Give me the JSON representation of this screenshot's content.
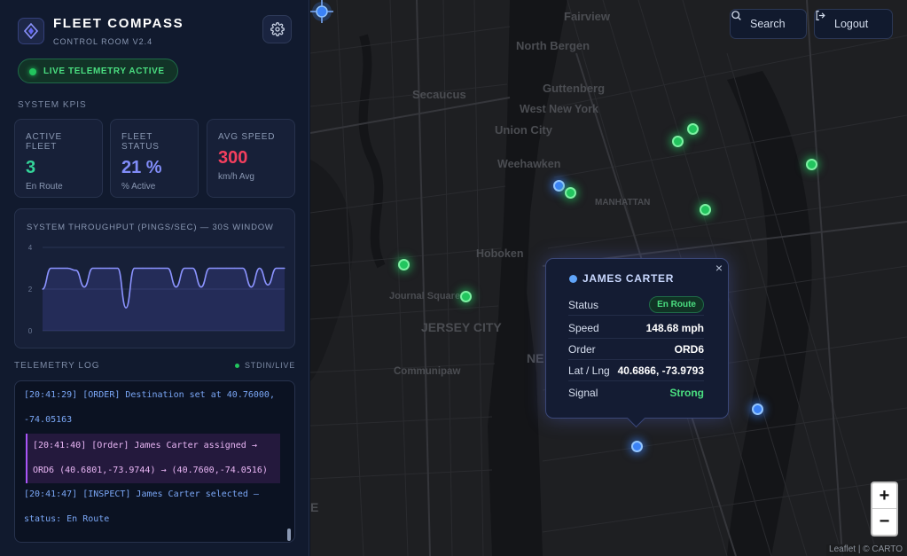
{
  "brand": {
    "title": "FLEET COMPASS",
    "subtitle": "CONTROL ROOM V2.4"
  },
  "icons": {
    "logo": "compass-logo-icon",
    "settings": "gear-icon",
    "search": "search-icon",
    "logout": "logout-icon"
  },
  "live_status": "LIVE TELEMETRY ACTIVE",
  "kpis": {
    "section_label": "SYSTEM KPIS",
    "items": [
      {
        "label": "ACTIVE FLEET",
        "value": "3",
        "unit": "En Route",
        "color": "#34d399"
      },
      {
        "label": "FLEET STATUS",
        "value": "21 %",
        "unit": "% Active",
        "color": "#818cf8"
      },
      {
        "label": "AVG SPEED",
        "value": "300",
        "unit": "km/h Avg",
        "color": "#f43f5e"
      }
    ]
  },
  "chart_data": {
    "type": "line",
    "title": "SYSTEM THROUGHPUT (PINGS/SEC) — 30S WINDOW",
    "ylim": [
      0,
      4
    ],
    "yticks": [
      "4",
      "2",
      "0"
    ],
    "grid": true,
    "x": [
      0,
      1,
      2,
      3,
      4,
      5,
      6,
      7,
      8,
      9,
      10,
      11,
      12,
      13,
      14,
      15,
      16,
      17,
      18,
      19,
      20,
      21,
      22,
      23,
      24,
      25,
      26,
      27,
      28,
      29
    ],
    "values": [
      2.0,
      3.0,
      3.0,
      3.0,
      2.9,
      2.1,
      3.0,
      3.0,
      3.0,
      3.0,
      1.1,
      3.0,
      3.0,
      3.0,
      3.0,
      3.0,
      2.1,
      3.0,
      3.0,
      2.1,
      3.0,
      3.0,
      3.0,
      3.0,
      3.0,
      2.1,
      3.0,
      2.2,
      3.0,
      3.0
    ]
  },
  "log": {
    "title": "TELEMETRY LOG",
    "stream": "STDIN/LIVE",
    "lines": [
      {
        "text": "[20:41:29] [ORDER] Destination set at 40.76000,",
        "cont": "-74.05163"
      },
      {
        "text": "[20:41:40] [Order] James Carter assigned →",
        "cont": "ORD6 (40.6801,-73.9744) → (40.7600,-74.0516)"
      },
      {
        "text": "[20:41:47] [INSPECT] James Carter selected —",
        "cont": "status: En Route"
      }
    ]
  },
  "map": {
    "search_label": "Search",
    "logout_label": "Logout",
    "places": {
      "fairview": "Fairview",
      "north_bergen": "North Bergen",
      "secaucus": "Secaucus",
      "guttenberg": "Guttenberg",
      "west_new_york": "West New York",
      "union_city": "Union City",
      "weehawken": "Weehawken",
      "manhattan": "MANHATTAN",
      "hoboken": "Hoboken",
      "journal_square": "Journal Square",
      "jersey_city": "JERSEY CITY",
      "ne": "NE",
      "communipaw": "Communipaw",
      "e": "E"
    },
    "zoom_in": "+",
    "zoom_out": "−",
    "attribution": "Leaflet | © CARTO"
  },
  "popup": {
    "name": "JAMES CARTER",
    "close": "×",
    "rows": [
      {
        "key": "Status",
        "value": "En Route"
      },
      {
        "key": "Speed",
        "value": "148.68 mph"
      },
      {
        "key": "Order",
        "value": "ORD6"
      },
      {
        "key": "Lat / Lng",
        "value": "40.6866, -73.9793"
      },
      {
        "key": "Signal",
        "value": "Strong"
      }
    ]
  }
}
